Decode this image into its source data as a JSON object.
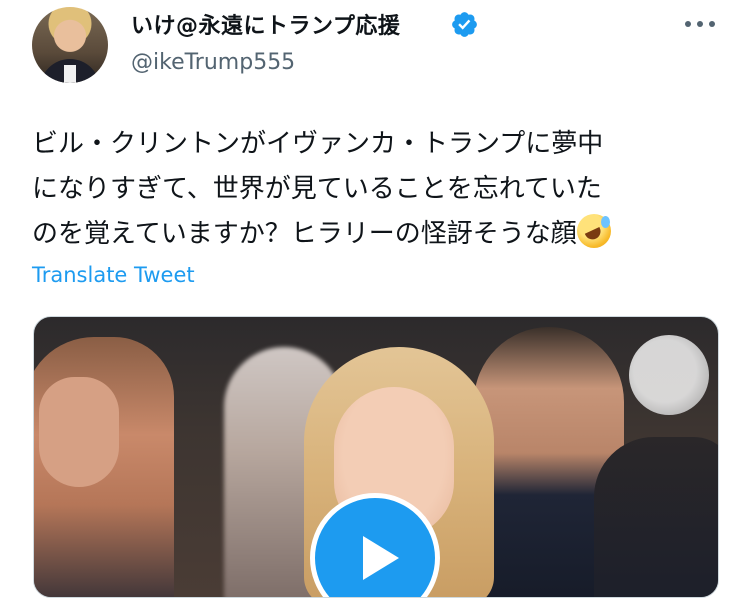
{
  "author": {
    "display_name": "いけ@永遠にトランプ応援",
    "handle": "@ikeTrump555",
    "verified": true,
    "avatar_icon": "avatar-photo"
  },
  "tweet": {
    "lines": [
      "ビル・クリントンがイヴァンカ・トランプに夢中",
      "になりすぎて、世界が見ていることを忘れていた",
      "のを覚えていますか？ヒラリーの怪訝そうな顔"
    ],
    "emoji": "rolling-on-the-floor-laughing-emoji",
    "translate_label": "Translate Tweet"
  },
  "media": {
    "type": "video",
    "play_icon": "play-icon",
    "watermark_icon": "watermark-logo"
  },
  "colors": {
    "accent": "#1d9bf0",
    "secondary_text": "#536471",
    "primary_text": "#0f1419"
  }
}
